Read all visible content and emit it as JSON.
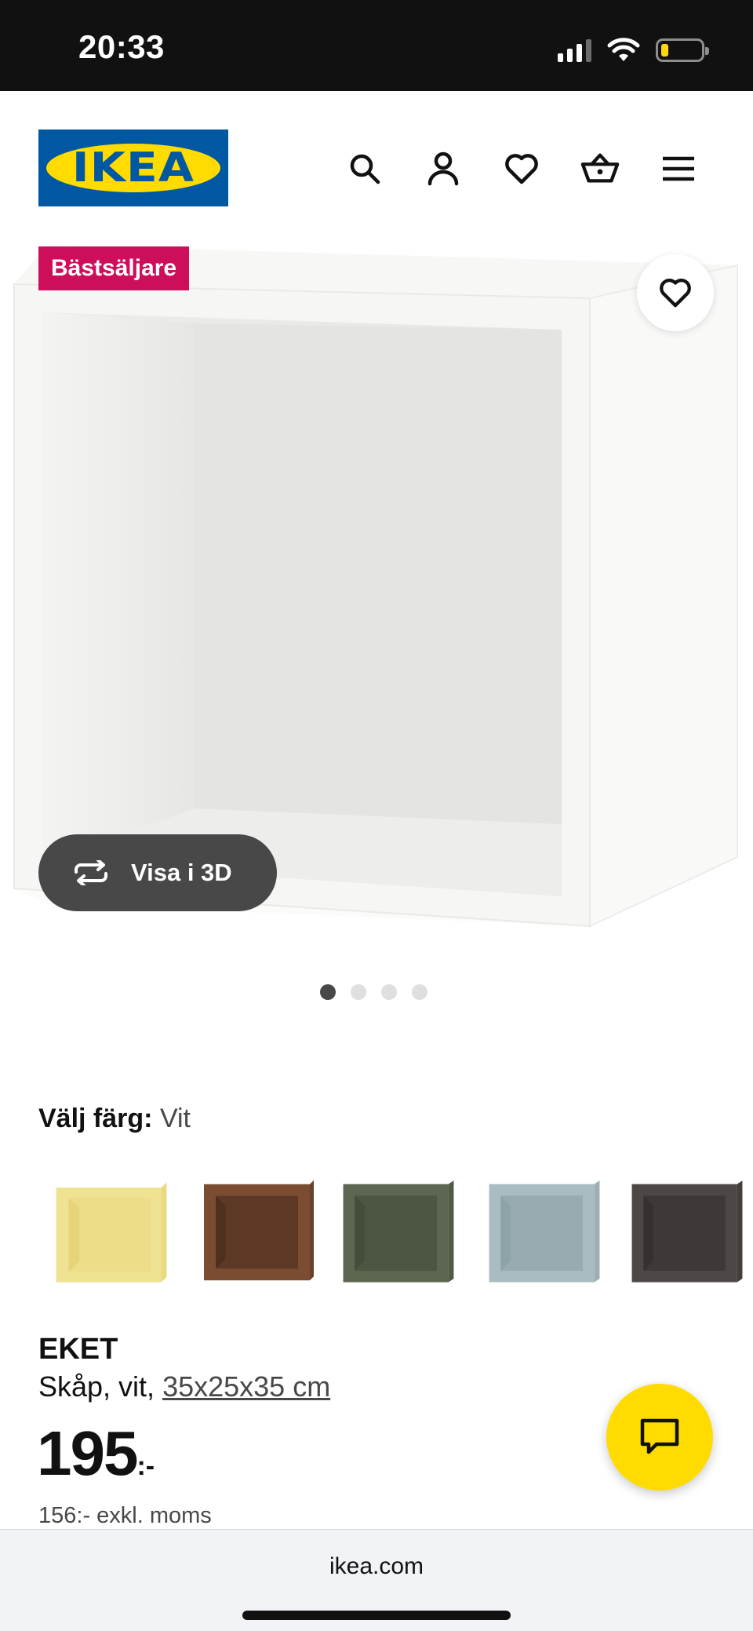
{
  "status_bar": {
    "time": "20:33",
    "signal_icon": "cellular-signal-icon",
    "wifi_icon": "wifi-icon",
    "battery_icon": "battery-low-icon",
    "battery_color": "#ffd60a"
  },
  "header": {
    "logo_text": "IKEA",
    "icons": [
      "search-icon",
      "account-icon",
      "heart-icon",
      "basket-icon",
      "menu-icon"
    ]
  },
  "product_image": {
    "badge": "Bästsäljare",
    "badge_color": "#cc0e5b",
    "favorite_icon": "heart-icon",
    "view_3d_label": "Visa i 3D",
    "view_3d_icon": "rotate-icon"
  },
  "pagination": {
    "total": 4,
    "active": 1
  },
  "color_picker": {
    "label": "Välj färg:",
    "selected": "Vit",
    "swatches": [
      {
        "name": "gul",
        "color": "#efe08e"
      },
      {
        "name": "valnöt",
        "color": "#7a4d33"
      },
      {
        "name": "grön",
        "color": "#5d6650"
      },
      {
        "name": "blå",
        "color": "#a9bcc0"
      },
      {
        "name": "mörkgrå",
        "color": "#4d4846"
      }
    ]
  },
  "product": {
    "name": "EKET",
    "description_prefix": "Skåp, vit, ",
    "size": "35x25x35 cm",
    "price_main": "195",
    "price_suffix": ":-",
    "price_excl": "156:- exkl. moms"
  },
  "chat": {
    "icon": "chat-icon",
    "color": "#ffdb00"
  },
  "browser": {
    "url": "ikea.com"
  }
}
